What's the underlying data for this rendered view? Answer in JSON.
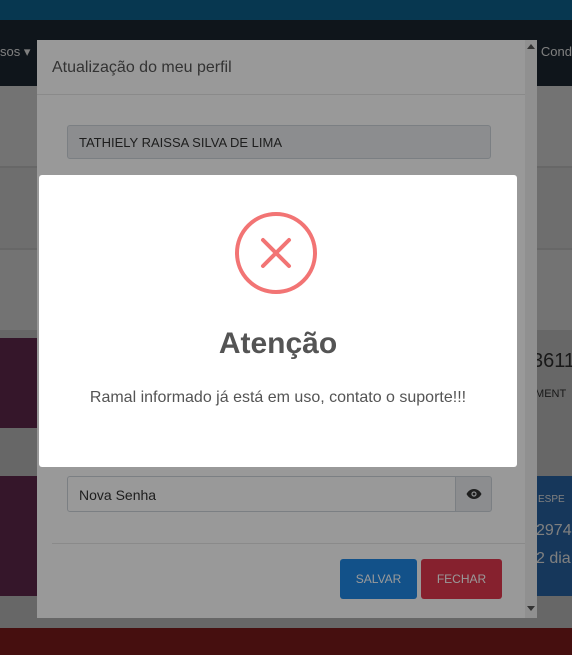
{
  "background": {
    "nav_left": "sos ▾",
    "nav_right": "Cond",
    "side_text_1": "3611",
    "side_text_2": "IMENT",
    "side_text_3": "ESPE",
    "side_text_4": "2974",
    "side_text_5": "2 dia"
  },
  "modal": {
    "title": "Atualização do meu perfil",
    "name_value": "TATHIELY RAISSA SILVA DE LIMA",
    "password_placeholder": "Nova Senha",
    "save_label": "SALVAR",
    "close_label": "FECHAR"
  },
  "alert": {
    "icon": "error-x-icon",
    "title": "Atenção",
    "message": "Ramal informado já está em uso, contato o suporte!!!"
  },
  "colors": {
    "error": "#f27474",
    "save": "#1e88e5",
    "close": "#e0374e"
  }
}
